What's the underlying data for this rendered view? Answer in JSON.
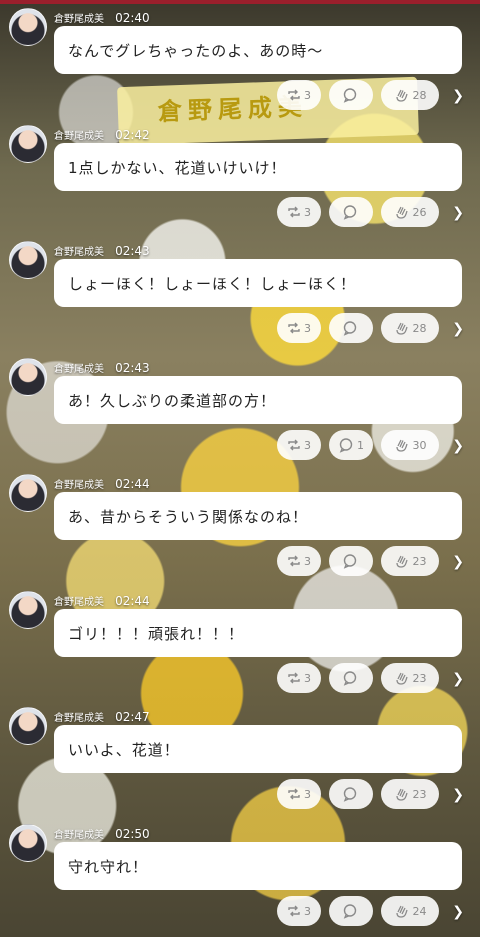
{
  "posts": [
    {
      "user": "倉野尾成美",
      "time": "02:40",
      "text": "なんでグレちゃったのよ、あの時〜",
      "retweets": "3",
      "replies": "",
      "claps": "28"
    },
    {
      "user": "倉野尾成美",
      "time": "02:42",
      "text": "1点しかない、花道いけいけ！",
      "retweets": "3",
      "replies": "",
      "claps": "26"
    },
    {
      "user": "倉野尾成美",
      "time": "02:43",
      "text": "しょーほく！しょーほく！しょーほく！",
      "retweets": "3",
      "replies": "",
      "claps": "28"
    },
    {
      "user": "倉野尾成美",
      "time": "02:43",
      "text": "あ！久しぶりの柔道部の方！",
      "retweets": "3",
      "replies": "1",
      "claps": "30"
    },
    {
      "user": "倉野尾成美",
      "time": "02:44",
      "text": "あ、昔からそういう関係なのね！",
      "retweets": "3",
      "replies": "",
      "claps": "23"
    },
    {
      "user": "倉野尾成美",
      "time": "02:44",
      "text": "ゴリ！！！頑張れ！！！",
      "retweets": "3",
      "replies": "",
      "claps": "23"
    },
    {
      "user": "倉野尾成美",
      "time": "02:47",
      "text": "いいよ、花道！",
      "retweets": "3",
      "replies": "",
      "claps": "23"
    },
    {
      "user": "倉野尾成美",
      "time": "02:50",
      "text": "守れ守れ！",
      "retweets": "3",
      "replies": "",
      "claps": "24"
    }
  ],
  "background": {
    "signboard_text": "倉野尾成美"
  },
  "icons": {
    "retweet": "retweet-icon",
    "reply": "speech-bubble-icon",
    "clap": "clap-icon",
    "more": "chevron-right-icon"
  },
  "colors": {
    "bubble": "#ffffff",
    "pill": "#ffffff",
    "accent_strip": "#9a1f2c"
  }
}
